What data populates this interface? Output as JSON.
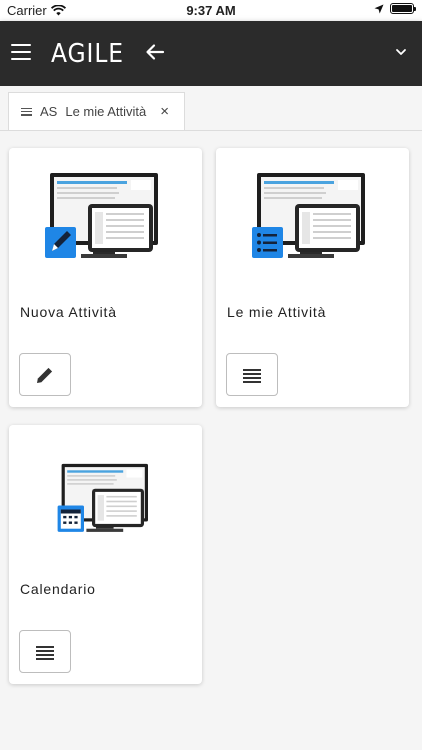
{
  "status_bar": {
    "carrier": "Carrier",
    "time": "9:37 AM"
  },
  "header": {
    "logo_text": "AGILE",
    "icons": [
      "menu-icon",
      "back-arrow-icon",
      "chevron-down-icon"
    ]
  },
  "tab": {
    "prefix": "AS",
    "label": "Le mie Attività",
    "close": "×"
  },
  "cards": [
    {
      "title": "Nuova Attività",
      "button_icon": "pencil-icon"
    },
    {
      "title": "Le mie Attività",
      "button_icon": "list-icon"
    },
    {
      "title": "Calendario",
      "button_icon": "list-icon"
    }
  ],
  "colors": {
    "header_bg": "#2b2b2b",
    "page_bg": "#f5f5f5",
    "accent_blue": "#1f86e6"
  }
}
